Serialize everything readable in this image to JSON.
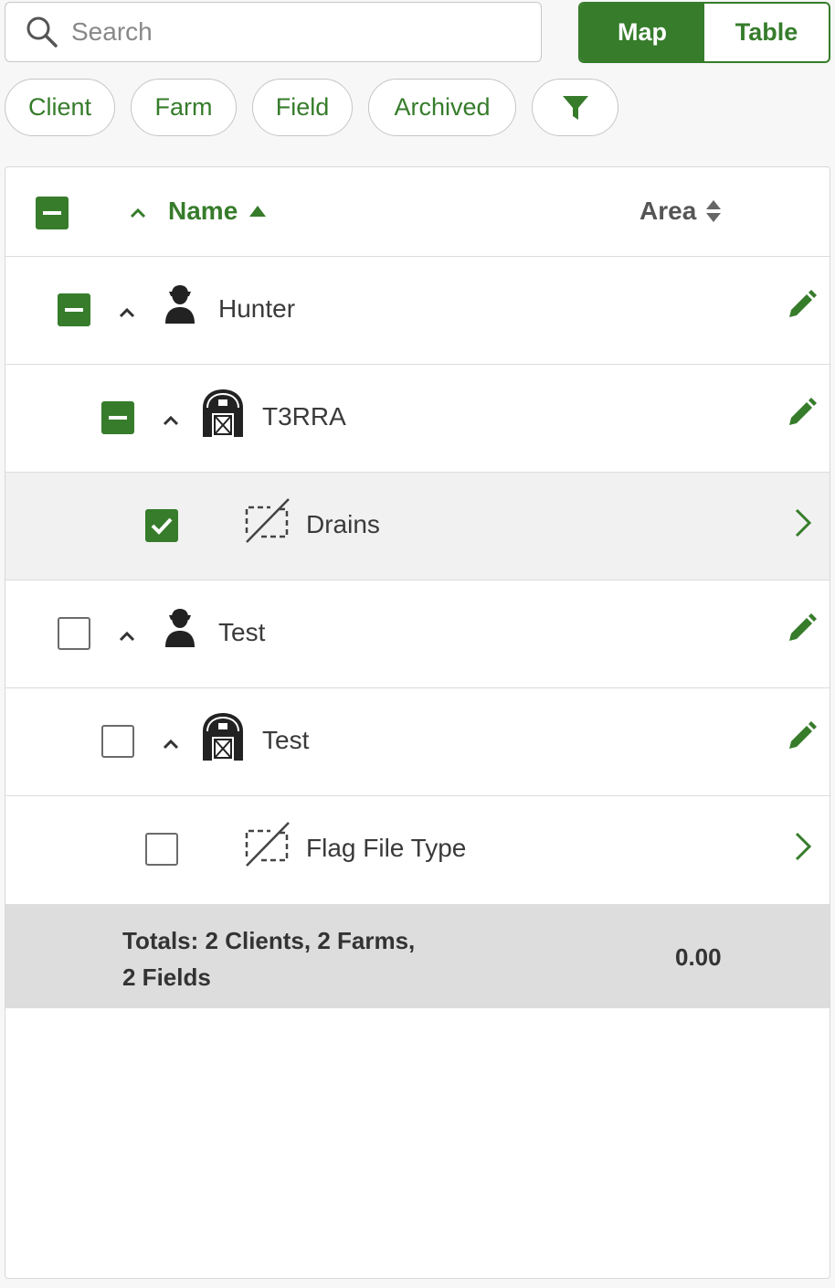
{
  "search": {
    "placeholder": "Search",
    "value": ""
  },
  "view_toggle": {
    "map": "Map",
    "table": "Table",
    "active": "Map"
  },
  "chips": [
    "Client",
    "Farm",
    "Field",
    "Archived"
  ],
  "header": {
    "name": "Name",
    "area": "Area"
  },
  "rows": [
    {
      "type": "client",
      "label": "Hunter",
      "checked": "partial"
    },
    {
      "type": "farm",
      "label": "T3RRA",
      "checked": "partial"
    },
    {
      "type": "field",
      "label": "Drains",
      "checked": "checked"
    },
    {
      "type": "client",
      "label": "Test",
      "checked": "none"
    },
    {
      "type": "farm",
      "label": "Test",
      "checked": "none"
    },
    {
      "type": "field",
      "label": "Flag File Type",
      "checked": "none"
    }
  ],
  "totals": {
    "line1": "Totals: 2 Clients, 2 Farms,",
    "line2": "2 Fields",
    "area": "0.00"
  },
  "colors": {
    "accent": "#367c2b"
  },
  "icons": [
    "search-icon",
    "filter-icon",
    "person-icon",
    "barn-icon",
    "field-boundary-icon",
    "pencil-icon",
    "chevron-right-icon",
    "caret-up-icon",
    "sort-icon"
  ]
}
